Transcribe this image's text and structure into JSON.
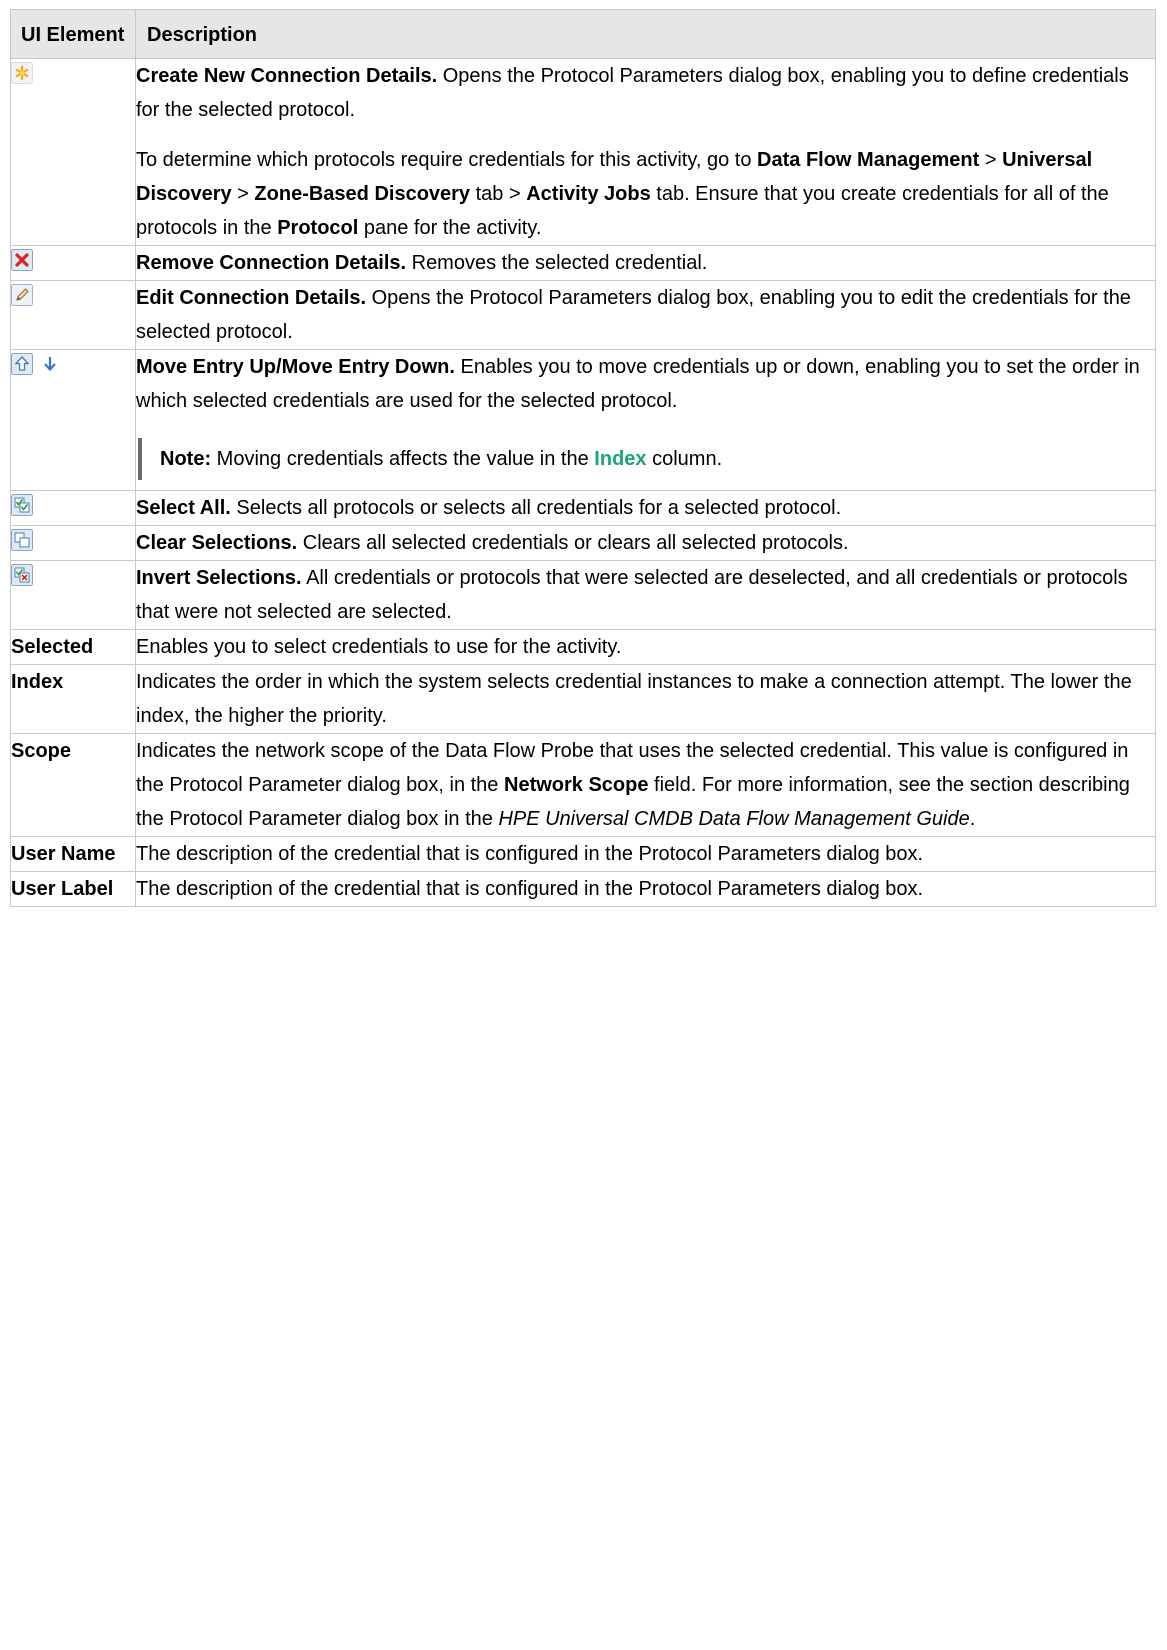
{
  "table": {
    "headers": {
      "element": "UI Element",
      "description": "Description"
    },
    "rows": [
      {
        "icon": "new-star-icon",
        "description": {
          "p1_bold": "Create New Connection Details.",
          "p1_text": " Opens the Protocol Parameters dialog box, enabling you to define credentials for the selected protocol.",
          "p2": {
            "t1": "To determine which protocols require credentials for this activity, go to ",
            "b1": "Data Flow Management",
            "t2": " > ",
            "b2": "Universal Discovery",
            "t3": " > ",
            "b3": "Zone-Based Discovery",
            "t4": " tab > ",
            "b4": "Activity Jobs",
            "t5": " tab. Ensure that you create credentials for all of the protocols in the ",
            "b5": "Protocol",
            "t6": " pane for the activity."
          }
        }
      },
      {
        "icon": "remove-x-icon",
        "description": {
          "bold": "Remove Connection Details.",
          "text": " Removes the selected credential."
        }
      },
      {
        "icon": "edit-pencil-icon",
        "description": {
          "bold": "Edit Connection Details.",
          "text": " Opens the Protocol Parameters dialog box, enabling you to edit the credentials for the selected protocol."
        }
      },
      {
        "icon": "move-up-down-icons",
        "description": {
          "bold": "Move Entry Up/Move Entry Down.",
          "text": " Enables you to move credentials up or down, enabling you to set the order in which selected credentials are used for the selected protocol.",
          "note_label": "Note:",
          "note_t1": " Moving credentials affects the value in the ",
          "note_link": "Index",
          "note_t2": " column."
        }
      },
      {
        "icon": "select-all-icon",
        "description": {
          "bold": "Select All.",
          "text": " Selects all protocols or selects all credentials for a selected protocol."
        }
      },
      {
        "icon": "clear-selections-icon",
        "description": {
          "bold": "Clear Selections.",
          "text": " Clears all selected credentials or clears all selected protocols."
        }
      },
      {
        "icon": "invert-selections-icon",
        "description": {
          "bold": "Invert Selections.",
          "text": " All credentials or protocols that were selected are deselected, and all credentials or protocols that were not selected are selected."
        }
      },
      {
        "element": "Selected",
        "description": {
          "text": "Enables you to select credentials to use for the activity."
        }
      },
      {
        "element": "Index",
        "description": {
          "text": "Indicates the order in which the system selects credential instances to make a connection attempt. The lower the index, the higher the priority."
        }
      },
      {
        "element": "Scope",
        "description": {
          "t1": "Indicates the network scope of the Data Flow Probe that uses the selected credential. This value is configured in the Protocol Parameter dialog box, in the ",
          "b1": "Network Scope",
          "t2": " field. For more information, see the section describing the Protocol Parameter dialog box in the ",
          "i1": "HPE Universal CMDB Data Flow Management Guide",
          "t3": "."
        }
      },
      {
        "element": "User Name",
        "description": {
          "text": "The description of the credential that is configured in the Protocol Parameters dialog box."
        }
      },
      {
        "element": "User Label",
        "description": {
          "text": "The description of the credential that is configured in the Protocol Parameters dialog box."
        }
      }
    ]
  }
}
